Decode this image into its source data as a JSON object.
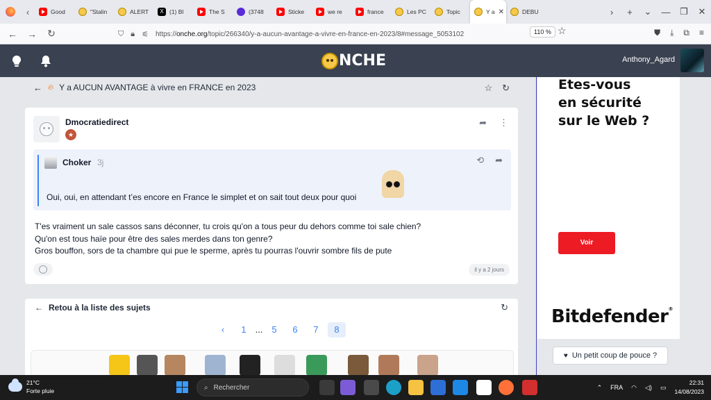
{
  "browser": {
    "tabs": [
      {
        "label": "Good",
        "icon": "youtube"
      },
      {
        "label": "\"Stalin",
        "icon": "onche"
      },
      {
        "label": "ALERT",
        "icon": "onche"
      },
      {
        "label": "(1) Bl",
        "icon": "x"
      },
      {
        "label": "The S",
        "icon": "youtube"
      },
      {
        "label": "(3748",
        "icon": "news"
      },
      {
        "label": "Sticke",
        "icon": "youtube"
      },
      {
        "label": "we re",
        "icon": "youtube"
      },
      {
        "label": "france",
        "icon": "youtube"
      },
      {
        "label": "Les PC",
        "icon": "onche"
      },
      {
        "label": "Topic",
        "icon": "onche"
      },
      {
        "label": "Y a",
        "icon": "onche",
        "active": true
      },
      {
        "label": "DEBU",
        "icon": "onche"
      }
    ],
    "url_prefix": "https://",
    "url_host": "onche.org",
    "url_path": "/topic/266340/y-a-aucun-avantage-a-vivre-en-france-en-2023/8#message_5053102",
    "zoom": "110 %"
  },
  "site": {
    "logo_text": "NCHE",
    "username": "Anthony_Agard"
  },
  "topic": {
    "title": "Y a AUCUN AVANTAGE à vivre en FRANCE en 2023"
  },
  "post": {
    "author": "Dmocratiedirect",
    "quote": {
      "author": "Choker",
      "time": "3j",
      "text": "Oui, oui, en attendant t’es encore en France le simplet et on sait tout deux pour quoi"
    },
    "body": [
      "T'es vraiment un sale cassos sans déconner, tu crois qu'on a tous peur du dehors comme toi sale chien?",
      "Qu'on est tous haïe pour être des sales merdes dans ton genre?",
      "Gros bouffon, sors de ta chambre qui pue le sperme, après tu pourras l'ouvrir sombre fils de pute"
    ],
    "date": "il y a 2 jours"
  },
  "list": {
    "back_label": "Retou à la liste des sujets",
    "pages": [
      "1",
      "...",
      "5",
      "6",
      "7",
      "8"
    ],
    "current_page": "8"
  },
  "ad": {
    "headline": [
      "Etes-vous",
      "en sécurité",
      "sur le Web ?"
    ],
    "button": "Voir",
    "brand": "Bitdefender",
    "thumbs": "Un petit coup de pouce ?"
  },
  "taskbar": {
    "temp": "21°C",
    "weather": "Forte pluie",
    "search": "Rechercher",
    "lang": "FRA",
    "time": "22:31",
    "date": "14/08/2023"
  },
  "colors": {
    "header_bg": "#3a4150",
    "accent": "#3b82f6",
    "ad_red": "#ed1b24"
  }
}
